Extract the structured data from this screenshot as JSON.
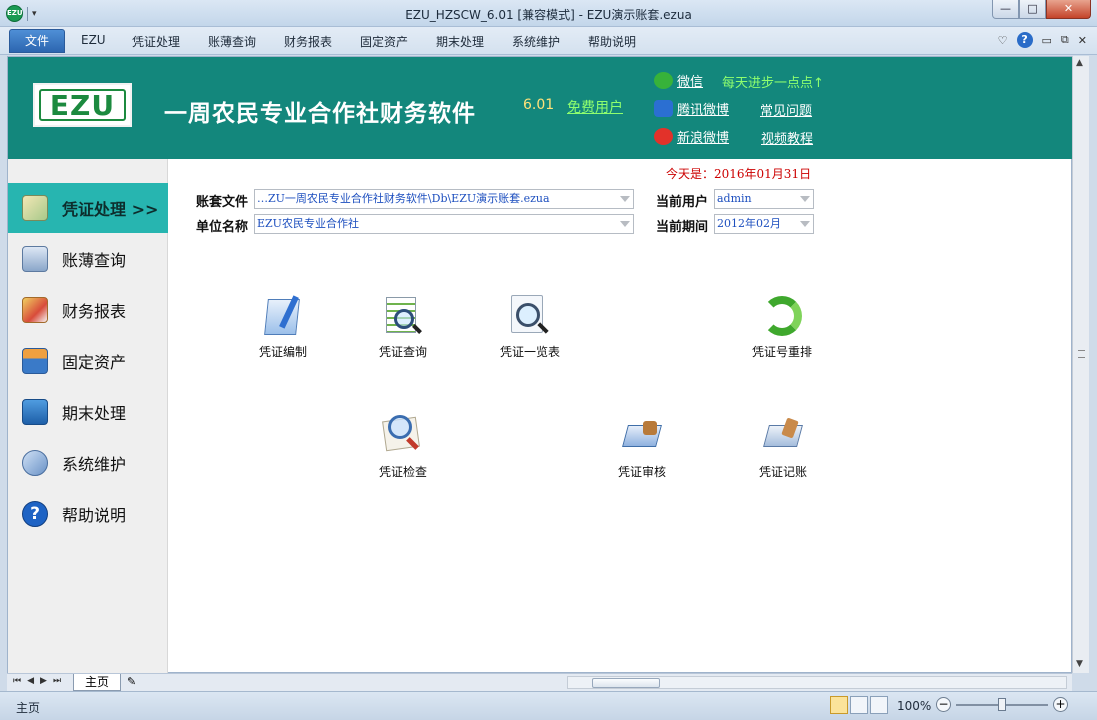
{
  "window": {
    "title": "EZU_HZSCW_6.01  [兼容模式]  -  EZU演示账套.ezua",
    "qa_icon": "EZU"
  },
  "menu": {
    "file": "文件",
    "items": [
      "EZU",
      "凭证处理",
      "账薄查询",
      "财务报表",
      "固定资产",
      "期末处理",
      "系统维护",
      "帮助说明"
    ]
  },
  "header": {
    "logo": "EZU",
    "title": "一周农民专业合作社财务软件",
    "version": "6.01",
    "free_user": "免费用户",
    "wechat": "微信",
    "slogan": "每天进步一点点↑",
    "tencent_weibo": "腾讯微博",
    "faq": "常见问题",
    "sina_weibo": "新浪微博",
    "video_tutorial": "视频教程"
  },
  "today": "今天是：2016年01月31日",
  "sidebar": {
    "items": [
      {
        "label": "凭证处理 >>",
        "icon": "voucher-icon",
        "active": true
      },
      {
        "label": "账薄查询",
        "icon": "ledger-icon"
      },
      {
        "label": "财务报表",
        "icon": "report-icon"
      },
      {
        "label": "固定资产",
        "icon": "asset-icon"
      },
      {
        "label": "期末处理",
        "icon": "period-end-icon"
      },
      {
        "label": "系统维护",
        "icon": "maintenance-icon"
      },
      {
        "label": "帮助说明",
        "icon": "help-icon"
      }
    ]
  },
  "form": {
    "account_file_label": "账套文件",
    "account_file_value": "…ZU一周农民专业合作社财务软件\\Db\\EZU演示账套.ezua",
    "unit_label": "单位名称",
    "unit_value": "EZU农民专业合作社",
    "user_label": "当前用户",
    "user_value": "admin",
    "period_label": "当前期间",
    "period_value": "2012年02月"
  },
  "tiles": {
    "compile": "凭证编制",
    "query": "凭证查询",
    "overview": "凭证一览表",
    "renumber": "凭证号重排",
    "check": "凭证检查",
    "audit": "凭证审核",
    "post": "凭证记账"
  },
  "sheet_tab": "主页",
  "status": {
    "text": "主页",
    "zoom": "100%"
  },
  "colors": {
    "header_bg": "#13877c",
    "sidebar_active": "#27b5b0",
    "date_red": "#cc0000",
    "link_green": "#8fff6e"
  }
}
